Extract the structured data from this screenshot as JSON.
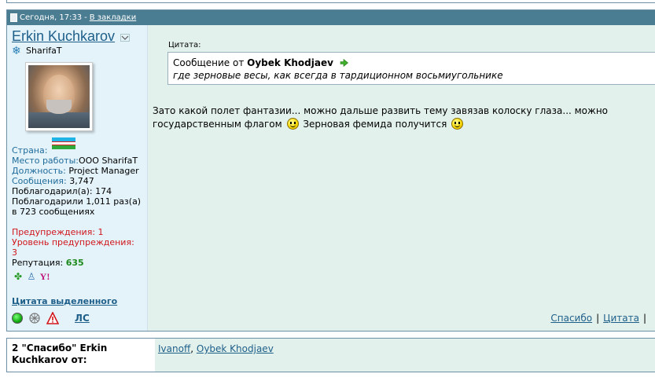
{
  "post": {
    "date": "Сегодня, 17:33",
    "separator": " - ",
    "bookmark_link": "В закладки",
    "user": {
      "name": "Erkin Kuchkarov",
      "title": "SharifaT",
      "country_label": "Страна:",
      "workplace_label": "Место работы:",
      "workplace": "ООО SharifaT",
      "position_label": "Должность:",
      "position": "Project Manager",
      "messages_label": "Сообщения:",
      "messages": "3,747",
      "thanked_label": "Поблагодарил(а):",
      "thanked": "174",
      "was_thanked_line1": "Поблагодарили 1,011 раз(а)",
      "was_thanked_line2": "в 723 сообщениях",
      "warnings": "Предупреждения: 1",
      "warning_level": "Уровень предупреждения: 3",
      "reputation_label": "Репутация:",
      "reputation": "635",
      "quote_selected": "Цитата выделенного",
      "pm_link": "ЛС"
    },
    "quote": {
      "label": "Цитата:",
      "prefix": "Сообщение от",
      "author": "Oybek Khodjaev",
      "text": "где зерновые весы, как всегда в тардиционном восьмиугольнике"
    },
    "message": {
      "line1": "Зато какой полет фантазии... можно дальше развить тему завязав колоску глаза... можно",
      "line2_part1": "государственным флагом",
      "line2_part2": "Зерновая фемида получится"
    },
    "actions": {
      "thanks": "Спасибо",
      "quote": "Цитата",
      "sep": "|"
    }
  },
  "thanks_bar": {
    "label": "2 \"Спасибо\" Erkin Kuchkarov от:",
    "users": [
      "Ivanoff",
      "Oybek Khodjaev"
    ],
    "sep": ","
  },
  "colors": {
    "header_bg": "#4b7d92",
    "userinfo_bg": "#e4f3fa",
    "content_bg": "#e3f1ec",
    "link": "#1e5f8a",
    "warning": "#d0151b",
    "reputation": "#1b8a1b"
  },
  "icons": {
    "header": "document-icon",
    "user_dropdown": "dropdown-arrow-icon",
    "usertitle": "snowflake-icon",
    "quote_goto": "green-arrow-icon",
    "status": "online-status-icon",
    "ip": "network-icon",
    "report": "warning-triangle-icon",
    "smiley": "smile-icon"
  }
}
